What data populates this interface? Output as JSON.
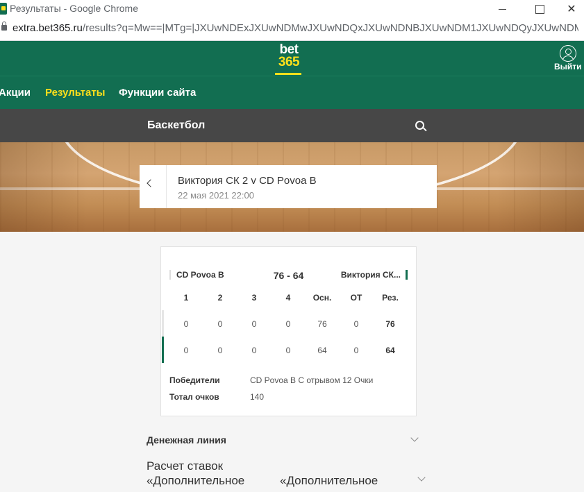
{
  "browser": {
    "window_title": "Результаты - Google Chrome",
    "url_domain": "extra.bet365.ru",
    "url_path": "/results?q=Mw==|MTg=|JXUwNDExJXUwNDMwJXUwNDQxJXUwNDNBJXUwNDM1JXUwNDQyJXUwNDM..."
  },
  "header": {
    "logo_top": "bet",
    "logo_bottom": "365",
    "logout_label": "Выйти"
  },
  "nav": {
    "items": [
      "Акции",
      "Результаты",
      "Функции сайта"
    ],
    "active": "Результаты"
  },
  "sport": {
    "title": "Баскетбол"
  },
  "match": {
    "title": "Виктория СК 2 v CD Povoa B",
    "date": "22 мая 2021 22:00"
  },
  "scoreboard": {
    "home_team": "CD Povoa B",
    "away_team": "Виктория СК...",
    "total_score": "76 - 64",
    "columns": [
      "1",
      "2",
      "3",
      "4",
      "Осн.",
      "ОТ",
      "Рез."
    ],
    "rows": [
      [
        "0",
        "0",
        "0",
        "0",
        "76",
        "0",
        "76"
      ],
      [
        "0",
        "0",
        "0",
        "0",
        "64",
        "0",
        "64"
      ]
    ],
    "winners_label": "Победители",
    "winners_value": "CD Povoa B С отрывом 12 Очки",
    "total_label": "Тотал очков",
    "total_value": "140"
  },
  "markets": {
    "money_line": "Денежная линия",
    "calc_line1": "Расчет ставок",
    "calc_line2_left": "«Дополнительное",
    "calc_line2_right": "«Дополнительное"
  },
  "colors": {
    "brand_green": "#126e51",
    "brand_yellow": "#ffdf1b",
    "sport_bar": "#474747"
  }
}
